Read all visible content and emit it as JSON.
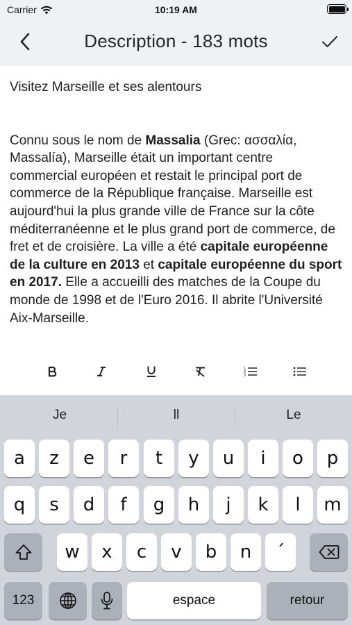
{
  "status_bar": {
    "carrier": "Carrier",
    "time": "10:19 AM"
  },
  "navbar": {
    "title": "Description - 183 mots"
  },
  "editor": {
    "line1": "Visitez Marseille et ses alentours",
    "para": {
      "t1": "Connu sous le nom de ",
      "b1": "Massalia",
      "t2": " (Grec: ασσαλία, Massalía), Marseille était un important centre commercial européen et restait le principal port de commerce de la République française. Marseille est aujourd'hui la plus grande ville de France sur la côte méditerranéenne et le plus grand port de commerce, de fret et de croisière. La ville a été ",
      "b2": "capitale européenne de la culture en 2013",
      "t3": " et ",
      "b3": "capitale européenne du sport en 2017.",
      "t4": " Elle a accueilli des matches de la Coupe du monde de 1998 et de l'Euro 2016. Il abrite l'Université Aix-Marseille."
    }
  },
  "format_toolbar": {
    "buttons": [
      "bold-icon",
      "italic-icon",
      "underline-icon",
      "clear-format-icon",
      "numbered-list-icon",
      "bulleted-list-icon"
    ]
  },
  "keyboard": {
    "suggestions": [
      "Je",
      "ll",
      "Le"
    ],
    "row1": [
      "a",
      "z",
      "e",
      "r",
      "t",
      "y",
      "u",
      "i",
      "o",
      "p"
    ],
    "row2": [
      "q",
      "s",
      "d",
      "f",
      "g",
      "h",
      "j",
      "k",
      "l",
      "m"
    ],
    "row3": [
      "w",
      "x",
      "c",
      "v",
      "b",
      "n",
      "´"
    ],
    "numbers_label": "123",
    "space_label": "espace",
    "return_label": "retour"
  },
  "colors": {
    "header_bg": "#eef2f5",
    "keyboard_bg": "#d1d4da",
    "special_key_bg": "#abb0b9"
  }
}
